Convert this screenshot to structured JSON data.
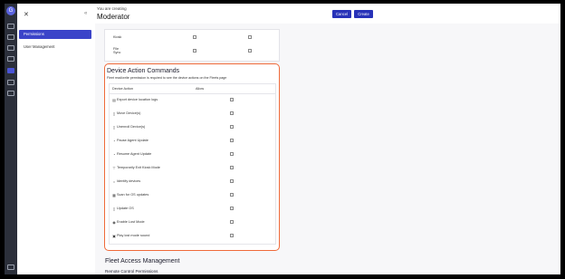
{
  "header": {
    "pre_title": "You are creating",
    "title": "Moderator",
    "cancel_label": "Cancel",
    "create_label": "Create"
  },
  "sidebar": {
    "items": [
      {
        "label": "Permissions",
        "active": true
      },
      {
        "label": "User Management",
        "active": false
      }
    ]
  },
  "top_permissions": [
    {
      "label": "Kiosk"
    },
    {
      "label": "File Sync"
    }
  ],
  "device_actions": {
    "title": "Device Action Commands",
    "subtitle": "Fleet read/write permission is required to see the device actions on the Fleets page",
    "col_action": "Device Action",
    "col_allow": "Allow",
    "rows": [
      {
        "label": "Export device location logs",
        "icon": "export-icon"
      },
      {
        "label": "Move Device(s)",
        "icon": "move-icon"
      },
      {
        "label": "Unenroll Device(s)",
        "icon": "unenroll-icon"
      },
      {
        "label": "Pause Agent Update",
        "icon": "pause-icon"
      },
      {
        "label": "Resume Agent Update",
        "icon": "resume-icon"
      },
      {
        "label": "Temporarily Exit Kiosk Mode",
        "icon": "pin-icon"
      },
      {
        "label": "Identify devices",
        "icon": "search-icon"
      },
      {
        "label": "Scan for OS updates",
        "icon": "scan-icon"
      },
      {
        "label": "Update OS",
        "icon": "update-icon"
      },
      {
        "label": "Enable Lost Mode",
        "icon": "lost-mode-icon"
      },
      {
        "label": "Play lost mode sound",
        "icon": "sound-icon"
      }
    ]
  },
  "fleet": {
    "title": "Fleet Access Management",
    "remote_title": "Remote Control Permissions"
  },
  "colors": {
    "accent": "#2732b8",
    "highlight": "#ef6a3a",
    "rail": "#2b2f3a"
  }
}
